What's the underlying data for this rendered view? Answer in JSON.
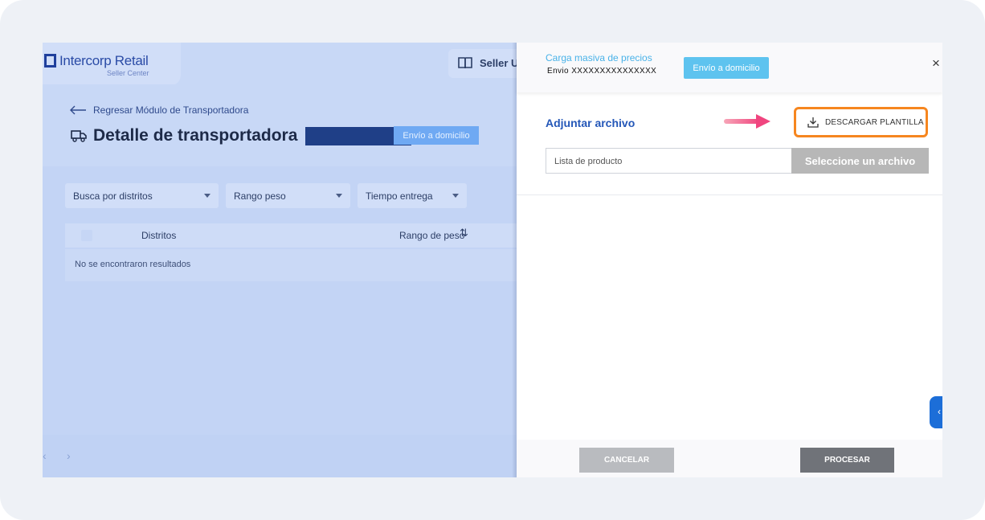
{
  "app": {
    "logo_title": "Intercorp Retail",
    "logo_subtitle": "Seller Center",
    "seller_label": "Seller U"
  },
  "page": {
    "back_link": "Regresar Módulo de Transportadora",
    "title": "Detalle de transportadora",
    "chip": "Envío a domicilio"
  },
  "filters": [
    {
      "label": "Busca por distritos"
    },
    {
      "label": "Rango peso"
    },
    {
      "label": "Tiempo entrega"
    }
  ],
  "table": {
    "columns": [
      "Distritos",
      "Rango de peso"
    ],
    "empty_message": "No se encontraron resultados"
  },
  "pager": {
    "prev": "‹",
    "next": "›"
  },
  "panel": {
    "title": "Carga masiva de precios",
    "subtitle": "Envio XXXXXXXXXXXXXXX",
    "chip": "Envío a domicilio",
    "close": "×",
    "attach_title": "Adjuntar archivo",
    "download_label": "DESCARGAR PLANTILLA",
    "file_placeholder": "Lista de producto",
    "file_button": "Seleccione un archivo",
    "cancel_label": "CANCELAR",
    "process_label": "PROCESAR"
  },
  "colors": {
    "accent_blue": "#2457b8",
    "highlight_orange": "#f6861f",
    "pointer_pink": "#f0457f"
  }
}
